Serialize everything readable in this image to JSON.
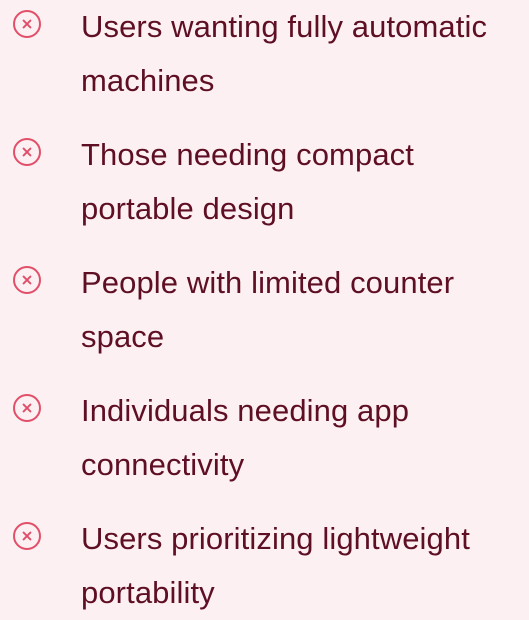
{
  "accent_color": "#e0506b",
  "text_color": "#5e0f24",
  "background_color": "#fdf0f2",
  "list": {
    "items": [
      {
        "icon": "x-circle-icon",
        "label": "Users wanting fully automatic machines"
      },
      {
        "icon": "x-circle-icon",
        "label": "Those needing compact portable design"
      },
      {
        "icon": "x-circle-icon",
        "label": "People with limited counter space"
      },
      {
        "icon": "x-circle-icon",
        "label": "Individuals needing app connectivity"
      },
      {
        "icon": "x-circle-icon",
        "label": "Users prioritizing lightweight portability"
      }
    ]
  }
}
